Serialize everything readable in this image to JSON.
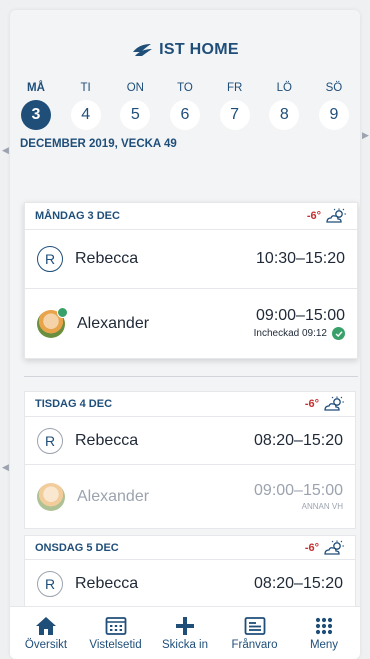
{
  "brand": {
    "name": "IST HOME"
  },
  "week": {
    "days": [
      {
        "name": "MÅ",
        "num": "3"
      },
      {
        "name": "TI",
        "num": "4"
      },
      {
        "name": "ON",
        "num": "5"
      },
      {
        "name": "TO",
        "num": "6"
      },
      {
        "name": "FR",
        "num": "7"
      },
      {
        "name": "LÖ",
        "num": "8"
      },
      {
        "name": "SÖ",
        "num": "9"
      }
    ],
    "label": "DECEMBER 2019, VECKA 49"
  },
  "cards": [
    {
      "title": "MÅNDAG 3 DEC",
      "temp": "-6°",
      "rows": [
        {
          "avatar": "R",
          "name": "Rebecca",
          "time": "10:30–15:20"
        },
        {
          "name": "Alexander",
          "time": "09:00–15:00",
          "sub": "Incheckad 09:12"
        }
      ]
    },
    {
      "title": "TISDAG 4 DEC",
      "temp": "-6°",
      "rows": [
        {
          "avatar": "R",
          "name": "Rebecca",
          "time": "08:20–15:20"
        },
        {
          "name": "Alexander",
          "time": "09:00–15:00",
          "sub": "ANNAN VH"
        }
      ]
    },
    {
      "title": "ONSDAG 5 DEC",
      "temp": "-6°",
      "rows": [
        {
          "avatar": "R",
          "name": "Rebecca",
          "time": "08:20–15:20"
        }
      ]
    }
  ],
  "nav": [
    {
      "label": "Översikt",
      "icon": "home-icon"
    },
    {
      "label": "Vistelsetid",
      "icon": "calendar-icon"
    },
    {
      "label": "Skicka in",
      "icon": "plus-icon"
    },
    {
      "label": "Frånvaro",
      "icon": "absence-list-icon"
    },
    {
      "label": "Meny",
      "icon": "grid-menu-icon"
    }
  ],
  "colors": {
    "primary": "#1f4e79",
    "temp": "#c53030",
    "success": "#38a169"
  }
}
